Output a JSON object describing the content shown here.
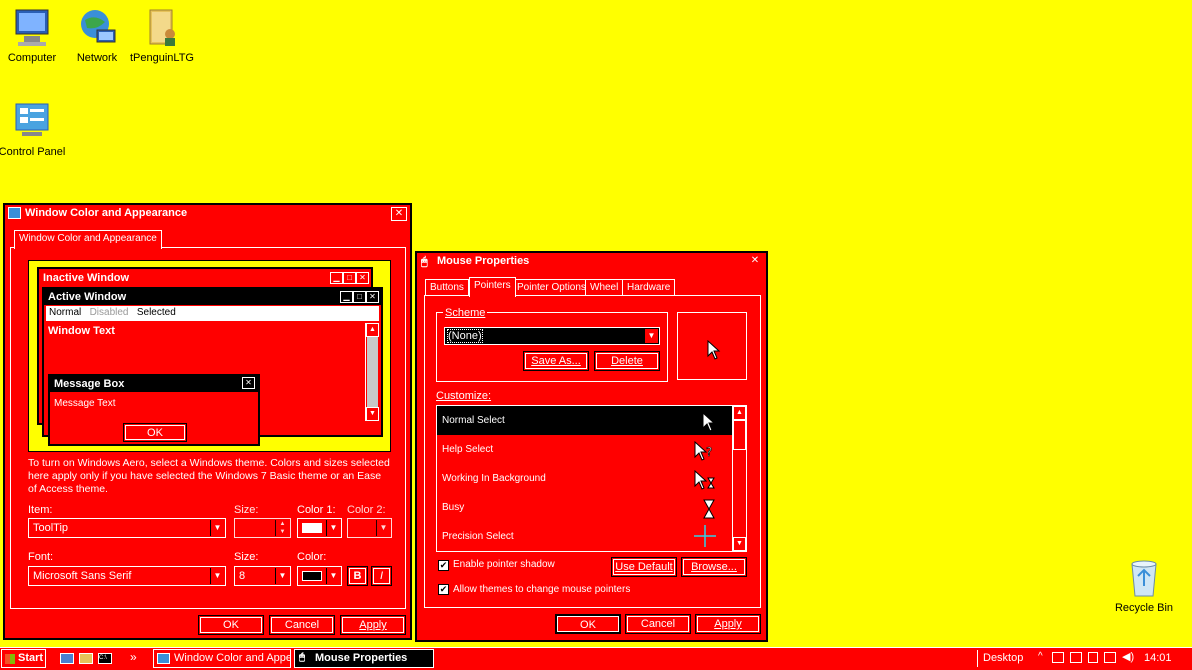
{
  "desktop": {
    "icons": [
      {
        "label": "Computer"
      },
      {
        "label": "Network"
      },
      {
        "label": "tPenguinLTG"
      },
      {
        "label": "Control Panel"
      },
      {
        "label": "Recycle Bin"
      }
    ],
    "background_color": "#FFFF00"
  },
  "appearance_window": {
    "title": "Window Color and Appearance",
    "tab": "Window Color and Appearance",
    "preview": {
      "inactive_title": "Inactive Window",
      "active_title": "Active Window",
      "menu_normal": "Normal",
      "menu_disabled": "Disabled",
      "menu_selected": "Selected",
      "window_text": "Window Text",
      "msgbox_title": "Message Box",
      "msgbox_text": "Message Text",
      "msgbox_ok": "OK"
    },
    "info_text": "To turn on Windows Aero, select a Windows theme.  Colors and sizes selected here apply only if you have selected the Windows 7 Basic theme or an Ease of Access theme.",
    "item_label": "Item:",
    "item_value": "ToolTip",
    "size_label": "Size:",
    "color1_label": "Color 1:",
    "color2_label": "Color 2:",
    "font_label": "Font:",
    "font_value": "Microsoft Sans Serif",
    "font_size_label": "Size:",
    "font_size_value": "8",
    "font_color_label": "Color:",
    "bold_label": "B",
    "italic_label": "I",
    "ok": "OK",
    "cancel": "Cancel",
    "apply": "Apply"
  },
  "mouse_window": {
    "title": "Mouse Properties",
    "tabs": [
      "Buttons",
      "Pointers",
      "Pointer Options",
      "Wheel",
      "Hardware"
    ],
    "active_tab": "Pointers",
    "scheme_label": "Scheme",
    "scheme_value": "(None)",
    "save_as": "Save As...",
    "delete": "Delete",
    "customize_label": "Customize:",
    "pointers": [
      {
        "name": "Normal Select",
        "icon": "arrow-cursor-icon"
      },
      {
        "name": "Help Select",
        "icon": "help-cursor-icon"
      },
      {
        "name": "Working In Background",
        "icon": "working-cursor-icon"
      },
      {
        "name": "Busy",
        "icon": "hourglass-cursor-icon"
      },
      {
        "name": "Precision Select",
        "icon": "crosshair-cursor-icon"
      }
    ],
    "enable_shadow": "Enable pointer shadow",
    "allow_themes": "Allow themes to change mouse pointers",
    "use_default": "Use Default",
    "browse": "Browse...",
    "ok": "OK",
    "cancel": "Cancel",
    "apply": "Apply"
  },
  "taskbar": {
    "start": "Start",
    "overflow": "»",
    "tasks": [
      {
        "label": "Window Color and Appea..."
      },
      {
        "label": "Mouse Properties"
      }
    ],
    "desktop_label": "Desktop",
    "time": "14:01"
  },
  "colors": {
    "accent": "#FF0000",
    "background": "#FFFF00",
    "selection": "#000000"
  }
}
